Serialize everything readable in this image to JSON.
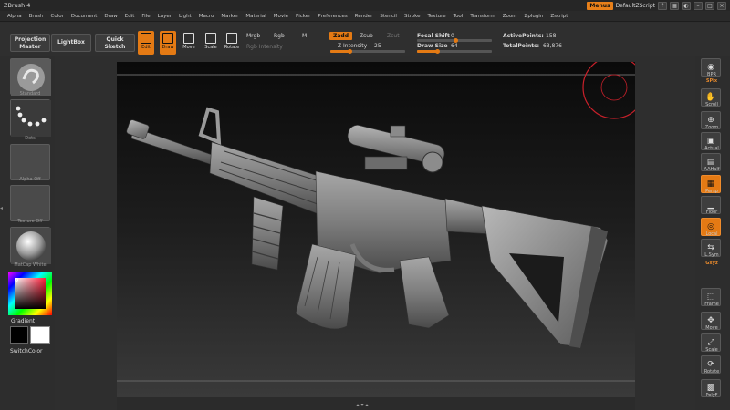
{
  "app": {
    "title": "ZBrush 4",
    "menus_button": "Menus",
    "script_name": "DefaultZScript"
  },
  "menubar": {
    "items": [
      "Alpha",
      "Brush",
      "Color",
      "Document",
      "Draw",
      "Edit",
      "File",
      "Layer",
      "Light",
      "Macro",
      "Marker",
      "Material",
      "Movie",
      "Picker",
      "Preferences",
      "Render",
      "Stencil",
      "Stroke",
      "Texture",
      "Tool",
      "Transform",
      "Zoom",
      "Zplugin",
      "Zscript"
    ]
  },
  "shelf": {
    "projection_master": "Projection Master",
    "lightbox": "LightBox",
    "quick_sketch": "Quick Sketch",
    "edit": "Edit",
    "draw": "Draw",
    "move": "Move",
    "scale": "Scale",
    "rotate": "Rotate",
    "mrgb": "Mrgb",
    "rgb": "Rgb",
    "m": "M",
    "rgb_intensity": "Rgb Intensity",
    "zadd": "Zadd",
    "zsub": "Zsub",
    "zcut": "Zcut",
    "z_intensity_label": "Z Intensity",
    "z_intensity_value": "25",
    "z_intensity_fraction": 0.25,
    "focal_shift_label": "Focal Shift",
    "focal_shift_value": "0",
    "draw_size_label": "Draw Size",
    "draw_size_value": "64",
    "active_points_label": "ActivePoints:",
    "active_points_value": "158",
    "total_points_label": "TotalPoints:",
    "total_points_value": "63,876"
  },
  "lefttray": {
    "standard": "Standard",
    "dots": "Dots",
    "alpha_off": "Alpha Off",
    "texture_off": "Texture Off",
    "matcap": "MatCap White",
    "gradient": "Gradient",
    "switch_color": "SwitchColor"
  },
  "righttray": {
    "bpr": "BPR",
    "spix_label": "SPix",
    "scroll": "Scroll",
    "zoom": "Zoom",
    "actual": "Actual",
    "aahalf": "AAHalf",
    "persp": "Persp",
    "floor": "Floor",
    "local": "Local",
    "lsym": "L.Sym",
    "xyz": "Gxyz",
    "frame": "Frame",
    "move": "Move",
    "scale": "Scale",
    "rotate": "Rotate",
    "polyf": "PolyF"
  },
  "colors": {
    "accent": "#e47a14",
    "background": "#2e2e2e",
    "canvas": "#1c1c1c"
  }
}
